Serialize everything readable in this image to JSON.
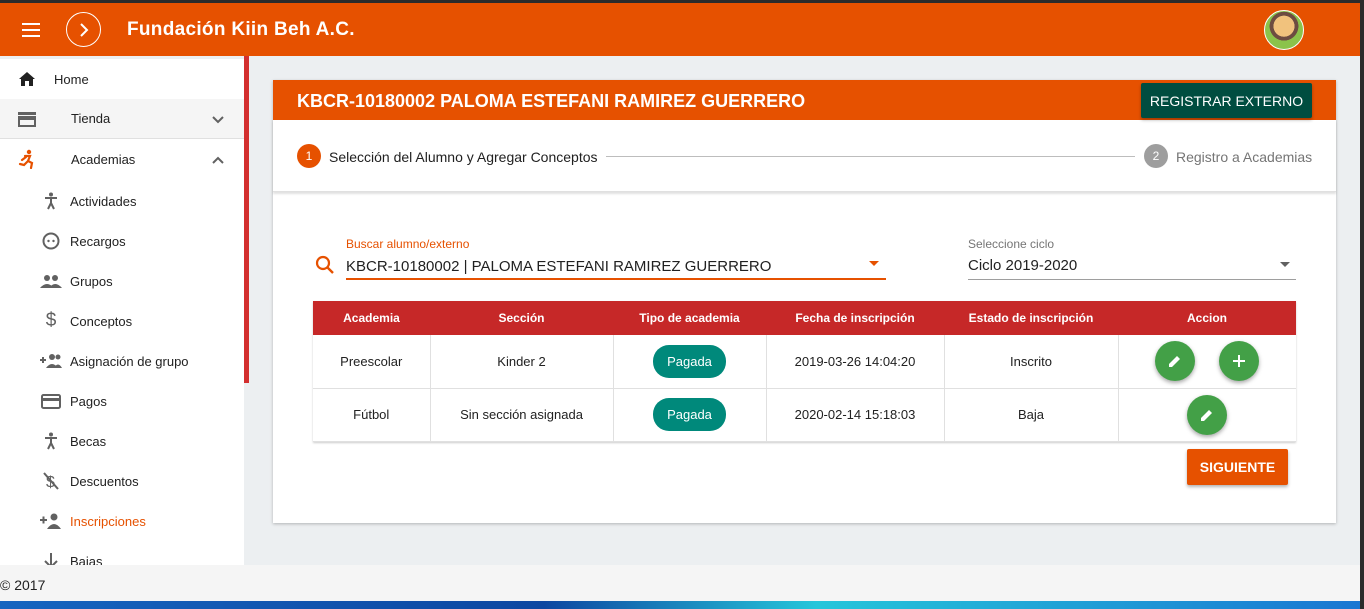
{
  "app": {
    "title": "Fundación Kiin Beh A.C."
  },
  "sidebar": {
    "items": [
      {
        "label": "Home",
        "icon": "home-icon"
      },
      {
        "label": "Tienda",
        "icon": "store-icon",
        "expanded": false
      },
      {
        "label": "Academias",
        "icon": "run-icon",
        "expanded": true
      }
    ],
    "subitems": [
      {
        "label": "Actividades",
        "icon": "accessibility-icon"
      },
      {
        "label": "Recargos",
        "icon": "face-icon"
      },
      {
        "label": "Grupos",
        "icon": "people-icon"
      },
      {
        "label": "Conceptos",
        "icon": "dollar-icon"
      },
      {
        "label": "Asignación de grupo",
        "icon": "group-add-icon"
      },
      {
        "label": "Pagos",
        "icon": "credit-card-icon"
      },
      {
        "label": "Becas",
        "icon": "accessibility-icon"
      },
      {
        "label": "Descuentos",
        "icon": "money-off-icon"
      },
      {
        "label": "Inscripciones",
        "icon": "person-add-icon",
        "active": true
      },
      {
        "label": "Bajas",
        "icon": "arrow-down-icon"
      }
    ]
  },
  "main": {
    "title": "KBCR-10180002 PALOMA ESTEFANI RAMIREZ GUERRERO",
    "register_button": "REGISTRAR EXTERNO",
    "steps": [
      {
        "number": "1",
        "label": "Selección del Alumno y Agregar Conceptos"
      },
      {
        "number": "2",
        "label": "Registro a Academias"
      }
    ],
    "search": {
      "label": "Buscar alumno/externo",
      "value": "KBCR-10180002 | PALOMA ESTEFANI RAMIREZ GUERRERO"
    },
    "cycle": {
      "label": "Seleccione ciclo",
      "value": "Ciclo 2019-2020"
    },
    "table": {
      "headers": [
        "Academia",
        "Sección",
        "Tipo de academia",
        "Fecha de inscripción",
        "Estado de inscripción",
        "Accion"
      ],
      "rows": [
        {
          "academia": "Preescolar",
          "seccion": "Kinder 2",
          "tipo": "Pagada",
          "fecha": "2019-03-26 14:04:20",
          "estado": "Inscrito"
        },
        {
          "academia": "Fútbol",
          "seccion": "Sin sección asignada",
          "tipo": "Pagada",
          "fecha": "2020-02-14 15:18:03",
          "estado": "Baja"
        }
      ]
    },
    "next_button": "SIGUIENTE"
  },
  "footer": {
    "copyright": "© 2017"
  },
  "colors": {
    "primary": "#e65100",
    "table_header": "#c62828",
    "badge": "#00897b",
    "fab": "#43a047",
    "dark_button": "#004d40"
  }
}
